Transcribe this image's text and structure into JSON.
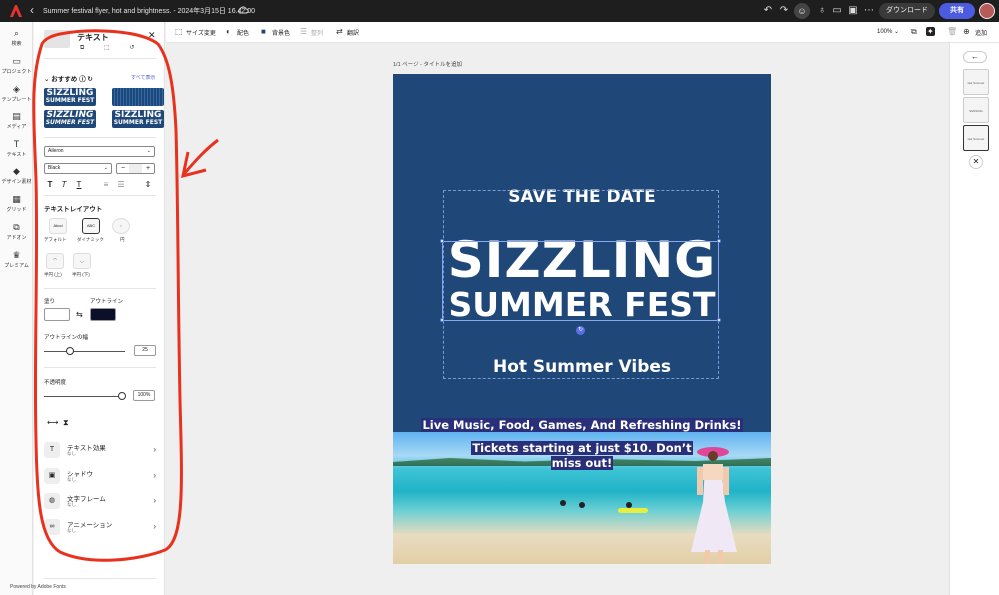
{
  "topbar": {
    "title": "Summer festival flyer, hot and brightness. - 2024年3月15日 16.42.00",
    "download_label": "ダウンロード",
    "share_label": "共有"
  },
  "rail": {
    "items": [
      {
        "label": "検索",
        "icon": "search-icon"
      },
      {
        "label": "プロジェクト",
        "icon": "folder-icon"
      },
      {
        "label": "テンプレート",
        "icon": "template-icon"
      },
      {
        "label": "メディア",
        "icon": "media-icon"
      },
      {
        "label": "テキスト",
        "icon": "text-icon"
      },
      {
        "label": "デザイン素材",
        "icon": "shapes-icon"
      },
      {
        "label": "グリッド",
        "icon": "grid-icon"
      },
      {
        "label": "アドオン",
        "icon": "addon-icon"
      },
      {
        "label": "プレミアム",
        "icon": "crown-icon"
      }
    ]
  },
  "panel": {
    "title": "テキスト",
    "recommended_label": "おすすめ",
    "see_all_label": "すべて表示",
    "styles": [
      {
        "line1": "SIZZLING",
        "line2": "SUMMER FEST"
      },
      {
        "line1": "",
        "line2": ""
      },
      {
        "line1": "SIZZLING",
        "line2": "SUMMER FEST"
      },
      {
        "line1": "SIZZLING",
        "line2": "SUMMER FEST"
      }
    ],
    "font_family": "Aileron",
    "font_weight": "Black",
    "layout_title": "テキストレイアウト",
    "layouts": [
      {
        "label": "デフォルト",
        "glyph": "Abcd"
      },
      {
        "label": "ダイナミック",
        "glyph": "ABC"
      },
      {
        "label": "円",
        "glyph": "◌"
      },
      {
        "label": "半円 (上)",
        "glyph": "⌒"
      },
      {
        "label": "半円 (下)",
        "glyph": "◡"
      }
    ],
    "fill_label": "塗り",
    "outline_label": "アウトライン",
    "fill_color": "#ffffff",
    "outline_color": "#0b0f2a",
    "outline_width_label": "アウトラインの幅",
    "outline_width_value": "25",
    "outline_width_level": 0.2,
    "opacity_label": "不透明度",
    "opacity_value": "100%",
    "opacity_level": 1.0,
    "effects": [
      {
        "title": "テキスト効果",
        "sub": "なし",
        "icon": "text-effect-icon"
      },
      {
        "title": "シャドウ",
        "sub": "なし",
        "icon": "shadow-icon"
      },
      {
        "title": "文字フレーム",
        "sub": "なし",
        "icon": "frame-icon"
      },
      {
        "title": "アニメーション",
        "sub": "なし",
        "icon": "animation-icon"
      }
    ],
    "powered_by": "Powered by Adobe Fonts"
  },
  "subbar": {
    "resize_label": "サイズ変更",
    "color_label": "配色",
    "bg_label": "背景色",
    "arrange_label": "整列",
    "translate_label": "翻訳",
    "zoom": "100%",
    "add_label": "追加"
  },
  "canvas": {
    "page_label": "1/1 ページ - タイトルを追加",
    "save_the_date": "SAVE THE DATE",
    "headline1": "SIZZLING",
    "headline2": "SUMMER FEST",
    "tagline": "Hot Summer Vibes",
    "line_music": "Live Music, Food, Games, And Refreshing Drinks!",
    "line_tickets": "Tickets starting at just $10. Don’t miss out!"
  },
  "strip": {
    "thumbs": [
      "Hot Summer Vibes",
      "SIZZLING SUMMER FEST",
      "Hot Summer Vibes"
    ]
  },
  "colors": {
    "accent": "#4b5ce0",
    "page_bg": "#1f4878",
    "annotation": "#e8321e"
  }
}
